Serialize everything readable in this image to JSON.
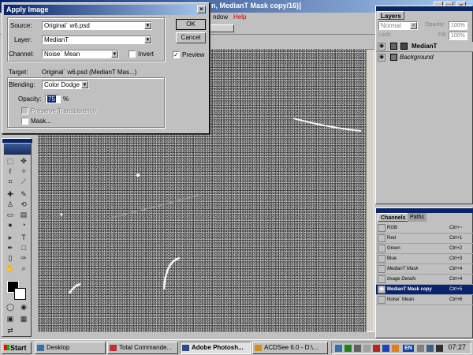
{
  "window": {
    "title": "n, MedianT Mask copy/16)]",
    "menu": [
      "ndow",
      "Help"
    ]
  },
  "dialog": {
    "title": "Apply Image",
    "source_label": "Source:",
    "source_value": "Original` w6.psd",
    "layer_label": "Layer:",
    "layer_value": "MedianT",
    "channel_label": "Channel:",
    "channel_value": "Noise` Mean",
    "invert_label": "Invert",
    "invert_checked": false,
    "target_label": "Target:",
    "target_value": "Original` w6.psd (MedianT Mas...)",
    "blending_label": "Blending:",
    "blending_value": "Color Dodge",
    "opacity_label": "Opacity:",
    "opacity_value": "75",
    "opacity_unit": "%",
    "preserve_label": "Preserve Transparency",
    "mask_label": "Mask...",
    "ok_label": "OK",
    "cancel_label": "Cancel",
    "preview_label": "Preview",
    "preview_checked": true
  },
  "layers_palette": {
    "tab": "Layers",
    "mode": "Normal",
    "opacity_label": "Opacity:",
    "opacity_value": "100%",
    "lock_label": "Lock:",
    "fill_label": "Fill:",
    "fill_value": "100%",
    "layers": [
      {
        "name": "MedianT",
        "selected": true
      },
      {
        "name": "Background",
        "selected": false
      }
    ]
  },
  "channels_palette": {
    "tabs": [
      "Channels",
      "Paths"
    ],
    "channels": [
      {
        "name": "RGB",
        "shortcut": "Ctrl+~",
        "selected": false
      },
      {
        "name": "Red",
        "shortcut": "Ctrl+1",
        "selected": false
      },
      {
        "name": "Green",
        "shortcut": "Ctrl+2",
        "selected": false
      },
      {
        "name": "Blue",
        "shortcut": "Ctrl+3",
        "selected": false
      },
      {
        "name": "MedianT Mask",
        "shortcut": "Ctrl+4",
        "selected": false
      },
      {
        "name": "Image Details",
        "shortcut": "Ctrl+4",
        "selected": false
      },
      {
        "name": "MedianT Mask copy",
        "shortcut": "Ctrl+5",
        "selected": true
      },
      {
        "name": "Noise` Mean",
        "shortcut": "Ctrl+6",
        "selected": false
      }
    ]
  },
  "taskbar": {
    "start_label": "Start",
    "tasks": [
      {
        "label": "Desktop",
        "active": false
      },
      {
        "label": "Total Commande...",
        "active": false
      },
      {
        "label": "Adobe Photosh...",
        "active": true
      },
      {
        "label": "ACDSee 6.0 - D:\\...",
        "active": false
      }
    ],
    "tray_lang": "EN",
    "clock": "07:27"
  },
  "colors": {
    "titlebar_start": "#0a246a",
    "titlebar_end": "#a6caf0",
    "face": "#c0c0c0",
    "selection": "#0a246a"
  }
}
